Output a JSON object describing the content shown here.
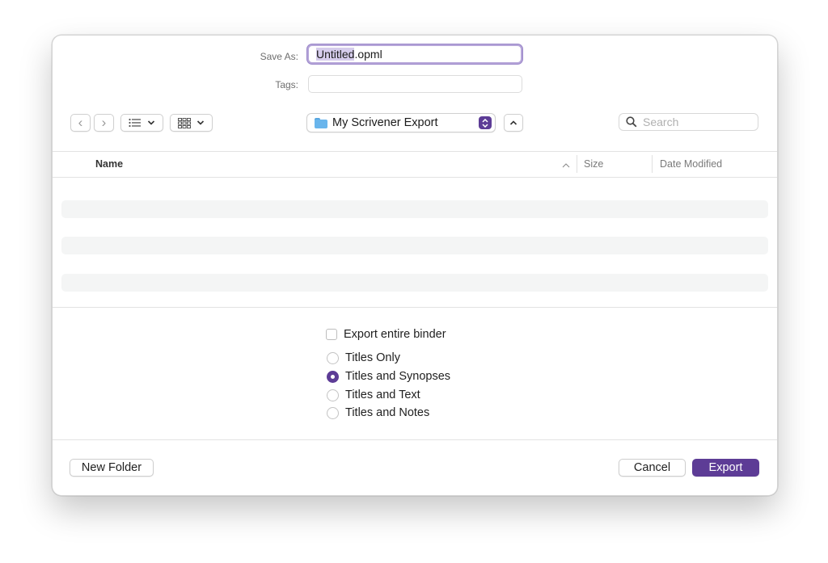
{
  "dialog": {
    "save_as_label": "Save As:",
    "filename_selected": "Untitled",
    "filename_rest": ".opml",
    "tags_label": "Tags:",
    "tags_value": ""
  },
  "toolbar": {
    "back_glyph": "‹",
    "forward_glyph": "›",
    "view_list_icon": "list-icon",
    "view_grid_icon": "grid-icon",
    "chevron_glyph": "⌄",
    "folder_name": "My Scrivener Export",
    "search_placeholder": "Search"
  },
  "columns": {
    "name": "Name",
    "size": "Size",
    "date_modified": "Date Modified",
    "sort_glyph": "^"
  },
  "options": {
    "export_binder": "Export entire binder",
    "export_binder_checked": false,
    "radios": [
      {
        "label": "Titles Only",
        "selected": false
      },
      {
        "label": "Titles and Synopses",
        "selected": true
      },
      {
        "label": "Titles and Text",
        "selected": false
      },
      {
        "label": "Titles and Notes",
        "selected": false
      }
    ]
  },
  "footer": {
    "new_folder": "New Folder",
    "cancel": "Cancel",
    "export": "Export"
  },
  "colors": {
    "accent": "#5d3c96",
    "focus_ring": "#b6a6d9",
    "folder_blue": "#69b5ec"
  }
}
